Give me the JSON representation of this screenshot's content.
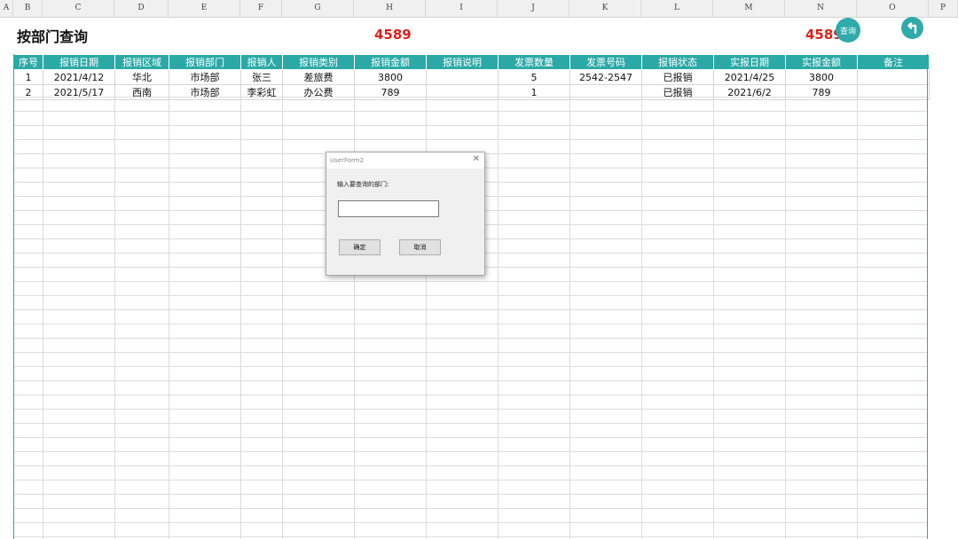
{
  "column_headers": [
    "A",
    "B",
    "C",
    "D",
    "E",
    "F",
    "G",
    "H",
    "I",
    "J",
    "K",
    "L",
    "M",
    "N",
    "O",
    "P"
  ],
  "header": {
    "title": "按部门查询",
    "total_left": "4589",
    "total_right": "4589",
    "query_button": "查询",
    "back_icon": "return-arrow-icon"
  },
  "table": {
    "columns": [
      "序号",
      "报销日期",
      "报销区域",
      "报销部门",
      "报销人",
      "报销类别",
      "报销金额",
      "报销说明",
      "发票数量",
      "发票号码",
      "报销状态",
      "实报日期",
      "实报金额",
      "备注"
    ],
    "rows": [
      [
        "1",
        "2021/4/12",
        "华北",
        "市场部",
        "张三",
        "差旅费",
        "3800",
        "",
        "5",
        "2542-2547",
        "已报销",
        "2021/4/25",
        "3800",
        ""
      ],
      [
        "2",
        "2021/5/17",
        "西南",
        "市场部",
        "李彩虹",
        "办公费",
        "789",
        "",
        "1",
        "",
        "已报销",
        "2021/6/2",
        "789",
        ""
      ]
    ]
  },
  "dialog": {
    "title": "UserForm2",
    "prompt": "输入要查询的部门:",
    "input_value": "",
    "ok_label": "确定",
    "cancel_label": "取消"
  },
  "colors": {
    "header_bg": "#2ba9a6",
    "total_color": "#e0201c",
    "button_bg": "#2faaaa"
  }
}
